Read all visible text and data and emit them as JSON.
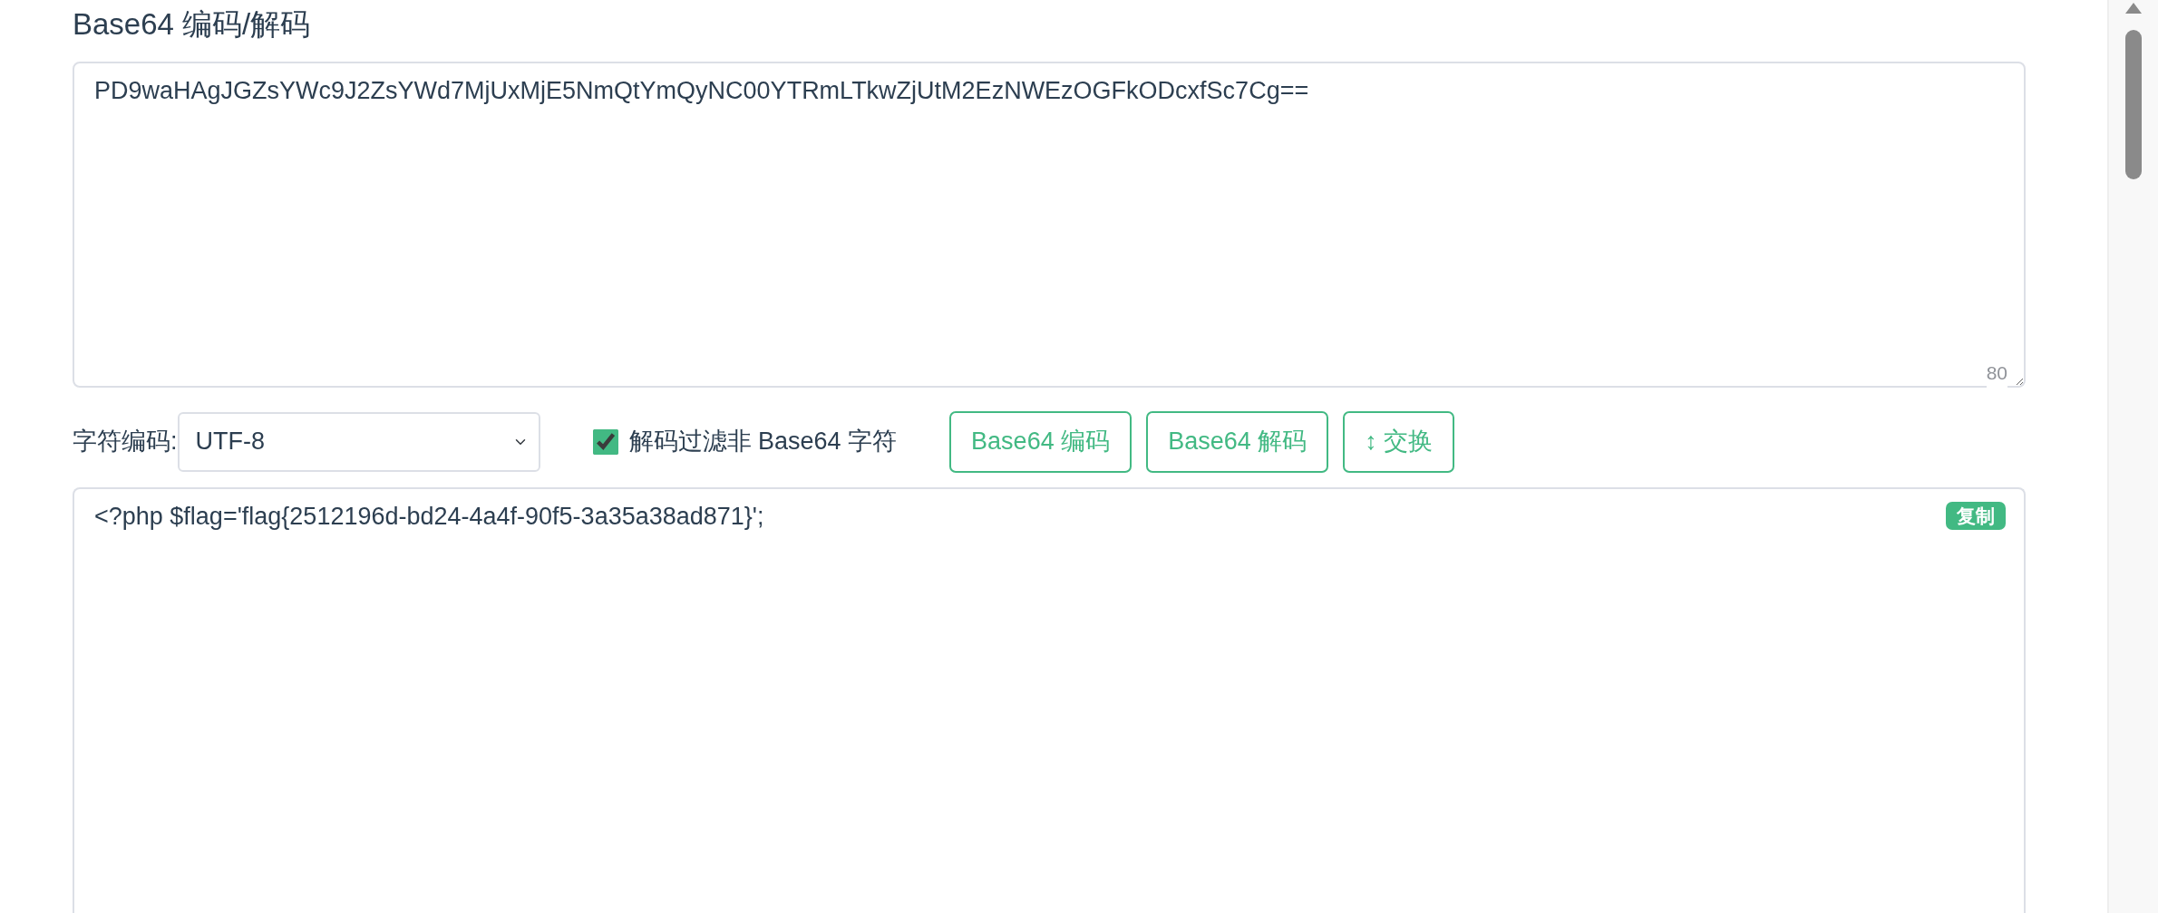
{
  "title": "Base64 编码/解码",
  "input": {
    "value": "PD9waHAgJGZsYWc9J2ZsYWd7MjUxMjE5NmQtYmQyNC00YTRmLTkwZjUtM2EzNWEzOGFkODcxfSc7Cg==",
    "count": "80"
  },
  "charset": {
    "label": "字符编码:",
    "value": "UTF-8"
  },
  "filter": {
    "label": "解码过滤非 Base64 字符",
    "checked": true
  },
  "buttons": [
    {
      "label": "Base64 编码"
    },
    {
      "label": "Base64 解码"
    },
    {
      "label": "↕ 交换"
    }
  ],
  "output": {
    "value": "<?php $flag='flag{2512196d-bd24-4a4f-90f5-3a35a38ad871}';",
    "copy_label": "复制"
  }
}
